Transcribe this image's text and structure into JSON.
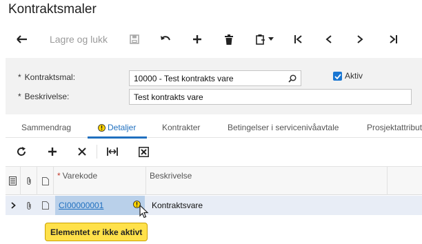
{
  "page": {
    "title": "Kontraktsmaler"
  },
  "toolbar": {
    "save_close_label": "Lagre og lukk",
    "icons": [
      "back-arrow-icon",
      "save-icon",
      "undo-icon",
      "plus-icon",
      "trash-icon",
      "clipboard-icon",
      "first-page-icon",
      "previous-icon",
      "next-icon",
      "last-page-icon"
    ]
  },
  "form": {
    "contract_template_label": "Kontraktsmal:",
    "contract_template_value": "10000 - Test kontrakts vare",
    "description_label": "Beskrivelse:",
    "description_value": "Test kontrakts vare",
    "active_label": "Aktiv",
    "active_checked": true,
    "required_marker": "*"
  },
  "tabs": [
    {
      "label": "Sammendrag"
    },
    {
      "label": "Detaljer"
    },
    {
      "label": "Kontrakter"
    },
    {
      "label": "Betingelser i servicenivåavtale"
    },
    {
      "label": "Prosjektattribut"
    }
  ],
  "grid": {
    "columns": {
      "item_code": "Varekode",
      "description": "Beskrivelse"
    },
    "rows": [
      {
        "item_code": "CI00000001",
        "description": "Kontraktsvare"
      }
    ],
    "tooltip": "Elementet er ikke aktivt"
  },
  "colors": {
    "accent": "#1f6fbf",
    "warning": "#ffe14a",
    "selected_row": "#e8edf6",
    "checkbox": "#1976d2"
  }
}
